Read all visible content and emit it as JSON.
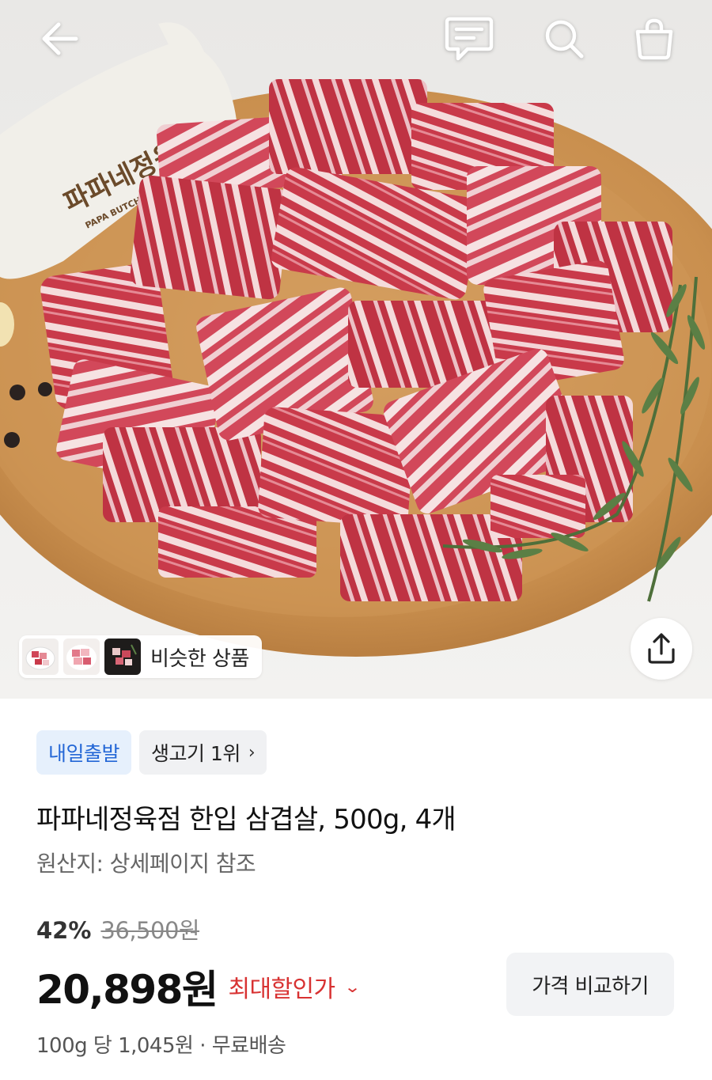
{
  "header": {
    "back_icon": "back-arrow-icon",
    "chat_icon": "chat-bubble-icon",
    "search_icon": "search-icon",
    "cart_icon": "shopping-bag-icon"
  },
  "hero": {
    "brand_mark": "파파네정육점",
    "brand_mark_en": "PAPA BUTCHER SHOP",
    "similar_products_label": "비슷한 상품",
    "share_icon": "share-icon"
  },
  "product": {
    "badge_delivery": "내일출발",
    "badge_rank": "생고기 1위",
    "title": "파파네정육점 한입 삼겹살, 500g, 4개",
    "origin": "원산지: 상세페이지 참조",
    "discount_rate": "42%",
    "original_price": "36,500원",
    "price": "20,898원",
    "max_discount_label": "최대할인가",
    "compare_button": "가격 비교하기",
    "unit_price": "100g 당 1,045원",
    "separator": "·",
    "shipping": "무료배송"
  },
  "colors": {
    "accent_blue": "#2467d6",
    "badge_blue_bg": "#e6f0fc",
    "discount_red": "#d83232",
    "board_wood": "#c98f4e"
  }
}
